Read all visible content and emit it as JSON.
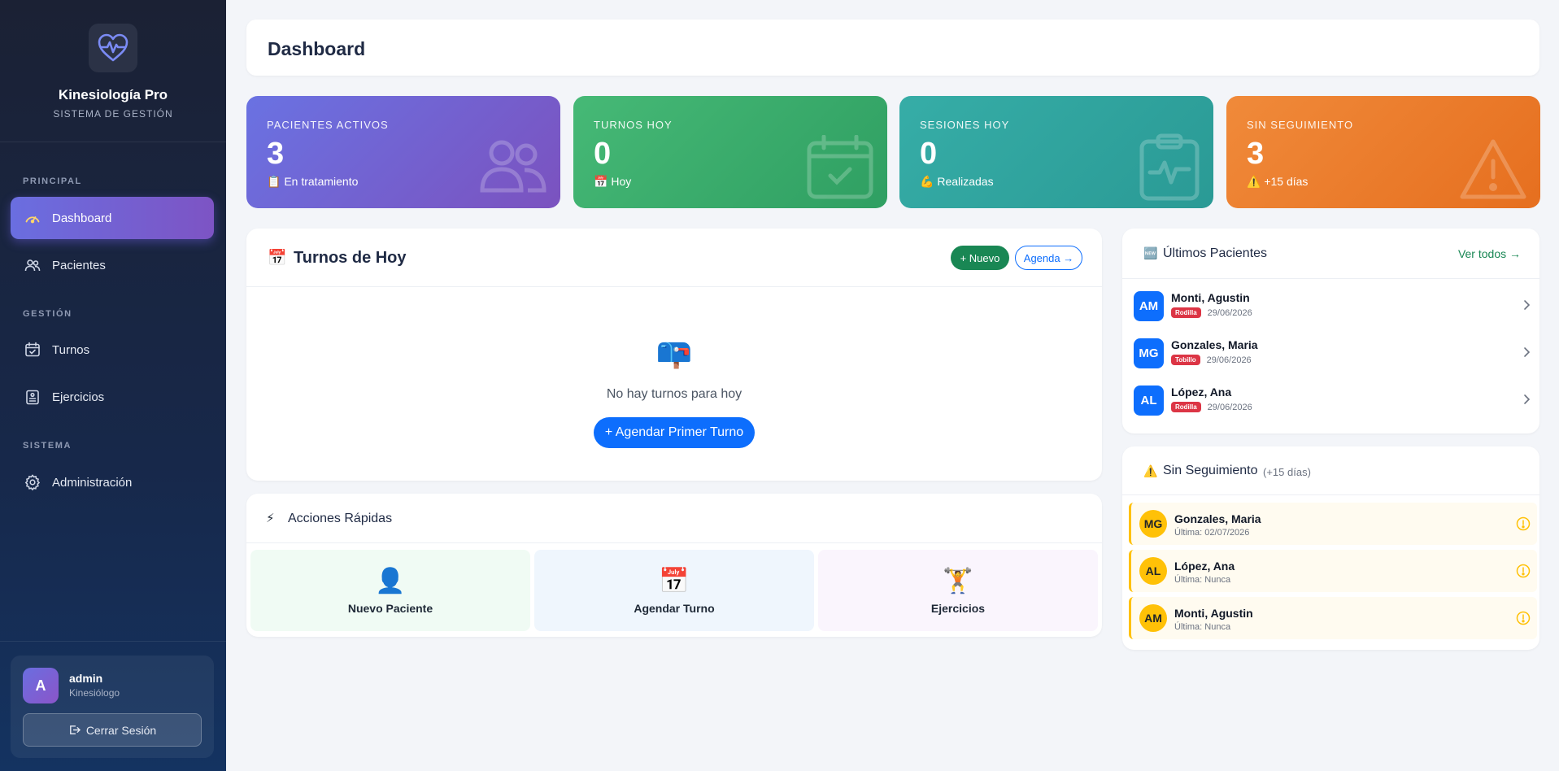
{
  "brand": {
    "title": "Kinesiología Pro",
    "subtitle": "SISTEMA DE GESTIÓN"
  },
  "nav": {
    "sections": [
      "PRINCIPAL",
      "GESTIÓN",
      "SISTEMA"
    ],
    "items": [
      {
        "label": "Dashboard",
        "icon": "gauge-icon",
        "active": true
      },
      {
        "label": "Pacientes",
        "icon": "users-icon"
      },
      {
        "label": "Turnos",
        "icon": "calendar-check-icon"
      },
      {
        "label": "Ejercicios",
        "icon": "clipboard-list-icon"
      },
      {
        "label": "Administración",
        "icon": "gear-icon"
      }
    ]
  },
  "user": {
    "initial": "A",
    "name": "admin",
    "role": "Kinesiólogo",
    "logout_label": "Cerrar Sesión"
  },
  "header": {
    "title": "Dashboard"
  },
  "stats": [
    {
      "label": "PACIENTES ACTIVOS",
      "value": "3",
      "sub_emoji": "📋",
      "sub": "En tratamiento",
      "color": "#6a6ee0"
    },
    {
      "label": "TURNOS HOY",
      "value": "0",
      "sub_emoji": "📅",
      "sub": "Hoy",
      "color": "#3aaf6e"
    },
    {
      "label": "SESIONES HOY",
      "value": "0",
      "sub_emoji": "💪",
      "sub": "Realizadas",
      "color": "#2ea59e"
    },
    {
      "label": "SIN SEGUIMIENTO",
      "value": "3",
      "sub_emoji": "⚠️",
      "sub": "+15 días",
      "color": "#ed7d2d"
    }
  ],
  "turnos": {
    "emoji": "📅",
    "title": "Turnos de Hoy",
    "new_label": "+ Nuevo",
    "agenda_label": "Agenda →",
    "empty_emoji": "📪",
    "empty_text": "No hay turnos para hoy",
    "cta_label": "+ Agendar Primer Turno"
  },
  "quick_actions": {
    "emoji": "⚡",
    "title": "Acciones Rápidas",
    "items": [
      {
        "emoji": "👤",
        "label": "Nuevo Paciente",
        "bg": "#f0fbf4"
      },
      {
        "emoji": "📅",
        "label": "Agendar Turno",
        "bg": "#eff6fd"
      },
      {
        "emoji": "🏋️",
        "label": "Ejercicios",
        "bg": "#faf5fd"
      }
    ]
  },
  "ultimos": {
    "emoji": "🆕",
    "title": "Últimos Pacientes",
    "link": "Ver todos →",
    "items": [
      {
        "initials": "AM",
        "name": "Monti, Agustin",
        "tag": "Rodilla",
        "date": "29/06/2026"
      },
      {
        "initials": "MG",
        "name": "Gonzales, Maria",
        "tag": "Tobillo",
        "date": "29/06/2026"
      },
      {
        "initials": "AL",
        "name": "López, Ana",
        "tag": "Rodilla",
        "date": "29/06/2026"
      }
    ]
  },
  "sin_seguimiento": {
    "emoji": "⚠️",
    "title": "Sin Seguimiento",
    "suffix": "(+15 días)",
    "items": [
      {
        "initials": "MG",
        "name": "Gonzales, Maria",
        "last": "Última: 02/07/2026"
      },
      {
        "initials": "AL",
        "name": "López, Ana",
        "last": "Última: Nunca"
      },
      {
        "initials": "AM",
        "name": "Monti, Agustin",
        "last": "Última: Nunca"
      }
    ]
  }
}
